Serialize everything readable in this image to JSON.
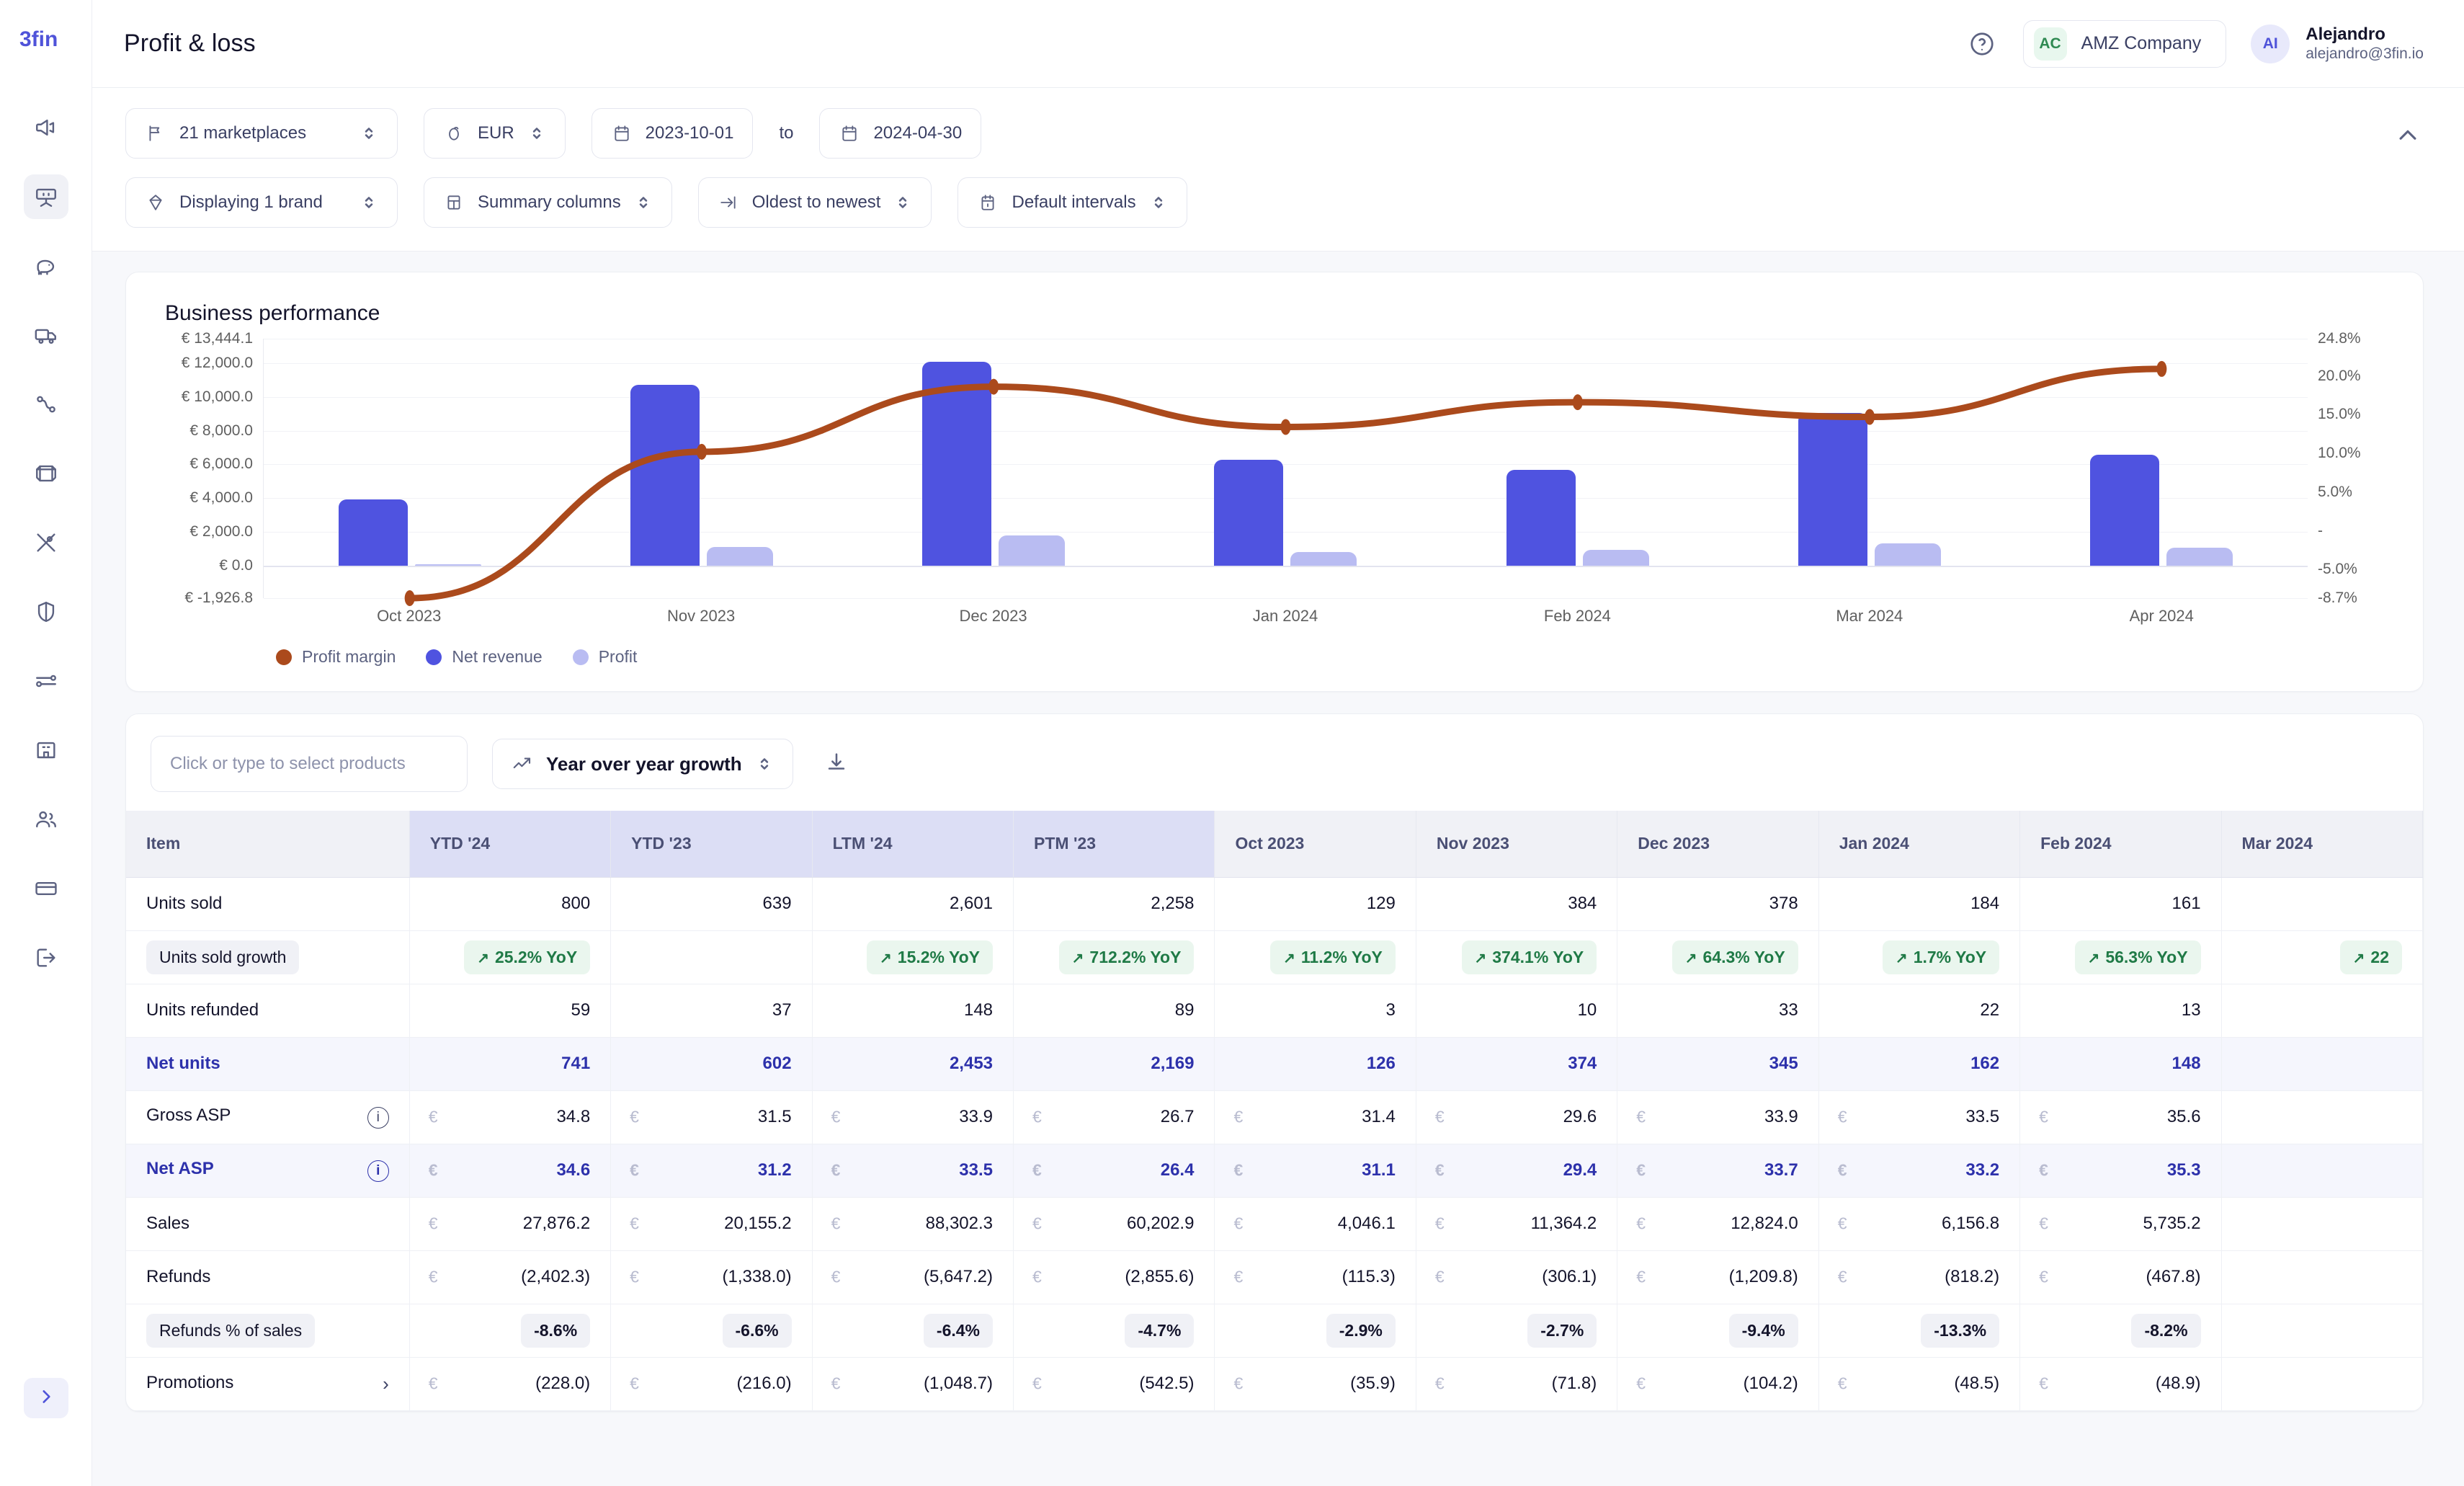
{
  "brand": {
    "logo_text": "3fin"
  },
  "header": {
    "page_title": "Profit & loss",
    "help_icon": "question-circle-icon",
    "company": {
      "initials": "AC",
      "name": "AMZ Company"
    },
    "user": {
      "initials": "AI",
      "name": "Alejandro",
      "email": "alejandro@3fin.io"
    }
  },
  "sidebar": {
    "items": [
      {
        "icon": "megaphone-icon",
        "name": "advertising",
        "active": false
      },
      {
        "icon": "dashboard-icon",
        "name": "profit-and-loss",
        "active": true
      },
      {
        "icon": "piggy-bank-icon",
        "name": "finance",
        "active": false
      },
      {
        "icon": "truck-icon",
        "name": "shipping",
        "active": false
      },
      {
        "icon": "route-icon",
        "name": "logistics",
        "active": false
      },
      {
        "icon": "box-icon",
        "name": "inventory",
        "active": false
      },
      {
        "icon": "tools-icon",
        "name": "tools",
        "active": false
      },
      {
        "icon": "shield-icon",
        "name": "protection",
        "active": false
      },
      {
        "icon": "sliders-icon",
        "name": "settings",
        "active": false
      },
      {
        "icon": "bank-icon",
        "name": "accounts",
        "active": false
      },
      {
        "icon": "users-icon",
        "name": "team",
        "active": false
      },
      {
        "icon": "credit-card-icon",
        "name": "billing",
        "active": false
      },
      {
        "icon": "logout-icon",
        "name": "logout",
        "active": false
      }
    ],
    "expand_icon": "chevron-right-icon"
  },
  "filters": {
    "marketplaces": {
      "label": "21 marketplaces",
      "icon": "flag-icon"
    },
    "currency": {
      "label": "EUR",
      "icon": "coin-icon"
    },
    "date_from": {
      "label": "2023-10-01",
      "icon": "calendar-icon"
    },
    "date_to_word": "to",
    "date_to": {
      "label": "2024-04-30",
      "icon": "calendar-icon"
    },
    "brand": {
      "label": "Displaying 1 brand",
      "icon": "diamond-icon"
    },
    "columns": {
      "label": "Summary columns",
      "icon": "columns-icon"
    },
    "sort": {
      "label": "Oldest to newest",
      "icon": "sort-icon"
    },
    "intervals": {
      "label": "Default intervals",
      "icon": "calendar-interval-icon"
    },
    "collapse_icon": "chevron-up-icon"
  },
  "chart_data": {
    "type": "bar",
    "title": "Business performance",
    "categories": [
      "Oct 2023",
      "Nov 2023",
      "Dec 2023",
      "Jan 2024",
      "Feb 2024",
      "Mar 2024",
      "Apr 2024"
    ],
    "series": [
      {
        "name": "Net revenue",
        "type": "bar",
        "color": "#4f53e0",
        "axis": "left",
        "values": [
          3930,
          10713,
          12058,
          6283,
          5660,
          9050,
          6560
        ]
      },
      {
        "name": "Profit",
        "type": "bar",
        "color": "#b9bcf2",
        "axis": "left",
        "values": [
          60,
          1090,
          1800,
          820,
          930,
          1310,
          1080
        ]
      },
      {
        "name": "Profit margin",
        "type": "line",
        "color": "#ab4a1c",
        "axis": "right",
        "values": [
          -8.7,
          10.2,
          18.6,
          13.4,
          16.6,
          14.7,
          20.9
        ]
      }
    ],
    "left_axis": {
      "label": "",
      "ticks": [
        "€ 13,444.1",
        "€ 12,000.0",
        "€ 10,000.0",
        "€ 8,000.0",
        "€ 6,000.0",
        "€ 4,000.0",
        "€ 2,000.0",
        "€ 0.0",
        "€ -1,926.8"
      ],
      "tick_values": [
        13444.1,
        12000.0,
        10000.0,
        8000.0,
        6000.0,
        4000.0,
        2000.0,
        0.0,
        -1926.8
      ],
      "ylim": [
        -1926.8,
        13444.1
      ]
    },
    "right_axis": {
      "label": "",
      "ticks": [
        "24.8%",
        "20.0%",
        "15.0%",
        "10.0%",
        "5.0%",
        "-",
        "-5.0%",
        "-8.7%"
      ],
      "tick_values": [
        24.8,
        20.0,
        15.0,
        10.0,
        5.0,
        0.0,
        -5.0,
        -8.7
      ],
      "ylim": [
        -8.7,
        24.8
      ]
    },
    "legend": [
      {
        "label": "Profit margin",
        "color": "#ab4a1c"
      },
      {
        "label": "Net revenue",
        "color": "#4f53e0"
      },
      {
        "label": "Profit",
        "color": "#b9bcf2"
      }
    ],
    "legend_position": "bottom-left",
    "grid": true
  },
  "table_toolbar": {
    "product_placeholder": "Click or type to select products",
    "metric_select": {
      "label": "Year over year growth",
      "icon": "trend-up-icon"
    },
    "download_icon": "download-icon"
  },
  "table": {
    "columns": [
      {
        "label": "Item",
        "kind": "item"
      },
      {
        "label": "YTD '24",
        "kind": "summary"
      },
      {
        "label": "YTD '23",
        "kind": "summary"
      },
      {
        "label": "LTM '24",
        "kind": "summary"
      },
      {
        "label": "PTM '23",
        "kind": "summary"
      },
      {
        "label": "Oct 2023",
        "kind": "period"
      },
      {
        "label": "Nov 2023",
        "kind": "period"
      },
      {
        "label": "Dec 2023",
        "kind": "period"
      },
      {
        "label": "Jan 2024",
        "kind": "period"
      },
      {
        "label": "Feb 2024",
        "kind": "period"
      },
      {
        "label": "Mar 2024",
        "kind": "period"
      }
    ],
    "rows": [
      {
        "label": "Units sold",
        "style": "plain",
        "currency": false,
        "badge": false,
        "values": [
          "800",
          "639",
          "2,601",
          "2,258",
          "129",
          "384",
          "378",
          "184",
          "161",
          ""
        ]
      },
      {
        "label": "Units sold growth",
        "style": "plain",
        "label_pill": true,
        "currency": false,
        "badge": "green",
        "values": [
          "25.2% YoY",
          "",
          "15.2% YoY",
          "712.2% YoY",
          "11.2% YoY",
          "374.1% YoY",
          "64.3% YoY",
          "1.7% YoY",
          "56.3% YoY",
          "22"
        ]
      },
      {
        "label": "Units refunded",
        "style": "plain",
        "currency": false,
        "badge": false,
        "values": [
          "59",
          "37",
          "148",
          "89",
          "3",
          "10",
          "33",
          "22",
          "13",
          ""
        ]
      },
      {
        "label": "Net units",
        "style": "alt",
        "currency": false,
        "badge": false,
        "values": [
          "741",
          "602",
          "2,453",
          "2,169",
          "126",
          "374",
          "345",
          "162",
          "148",
          ""
        ]
      },
      {
        "label": "Gross ASP",
        "style": "plain",
        "info": true,
        "currency": true,
        "badge": false,
        "values": [
          "34.8",
          "31.5",
          "33.9",
          "26.7",
          "31.4",
          "29.6",
          "33.9",
          "33.5",
          "35.6",
          ""
        ]
      },
      {
        "label": "Net ASP",
        "style": "alt",
        "info": true,
        "currency": true,
        "badge": false,
        "values": [
          "34.6",
          "31.2",
          "33.5",
          "26.4",
          "31.1",
          "29.4",
          "33.7",
          "33.2",
          "35.3",
          ""
        ]
      },
      {
        "label": "Sales",
        "style": "plain",
        "currency": true,
        "badge": false,
        "values": [
          "27,876.2",
          "20,155.2",
          "88,302.3",
          "60,202.9",
          "4,046.1",
          "11,364.2",
          "12,824.0",
          "6,156.8",
          "5,735.2",
          ""
        ]
      },
      {
        "label": "Refunds",
        "style": "plain",
        "currency": true,
        "badge": false,
        "values": [
          "(2,402.3)",
          "(1,338.0)",
          "(5,647.2)",
          "(2,855.6)",
          "(115.3)",
          "(306.1)",
          "(1,209.8)",
          "(818.2)",
          "(467.8)",
          ""
        ]
      },
      {
        "label": "Refunds % of sales",
        "style": "plain",
        "label_pill": true,
        "currency": false,
        "badge": "grey",
        "values": [
          "-8.6%",
          "-6.6%",
          "-6.4%",
          "-4.7%",
          "-2.9%",
          "-2.7%",
          "-9.4%",
          "-13.3%",
          "-8.2%",
          ""
        ]
      },
      {
        "label": "Promotions",
        "style": "plain",
        "caret": true,
        "currency": true,
        "badge": false,
        "values": [
          "(228.0)",
          "(216.0)",
          "(1,048.7)",
          "(542.5)",
          "(35.9)",
          "(71.8)",
          "(104.2)",
          "(48.5)",
          "(48.9)",
          ""
        ]
      }
    ]
  }
}
